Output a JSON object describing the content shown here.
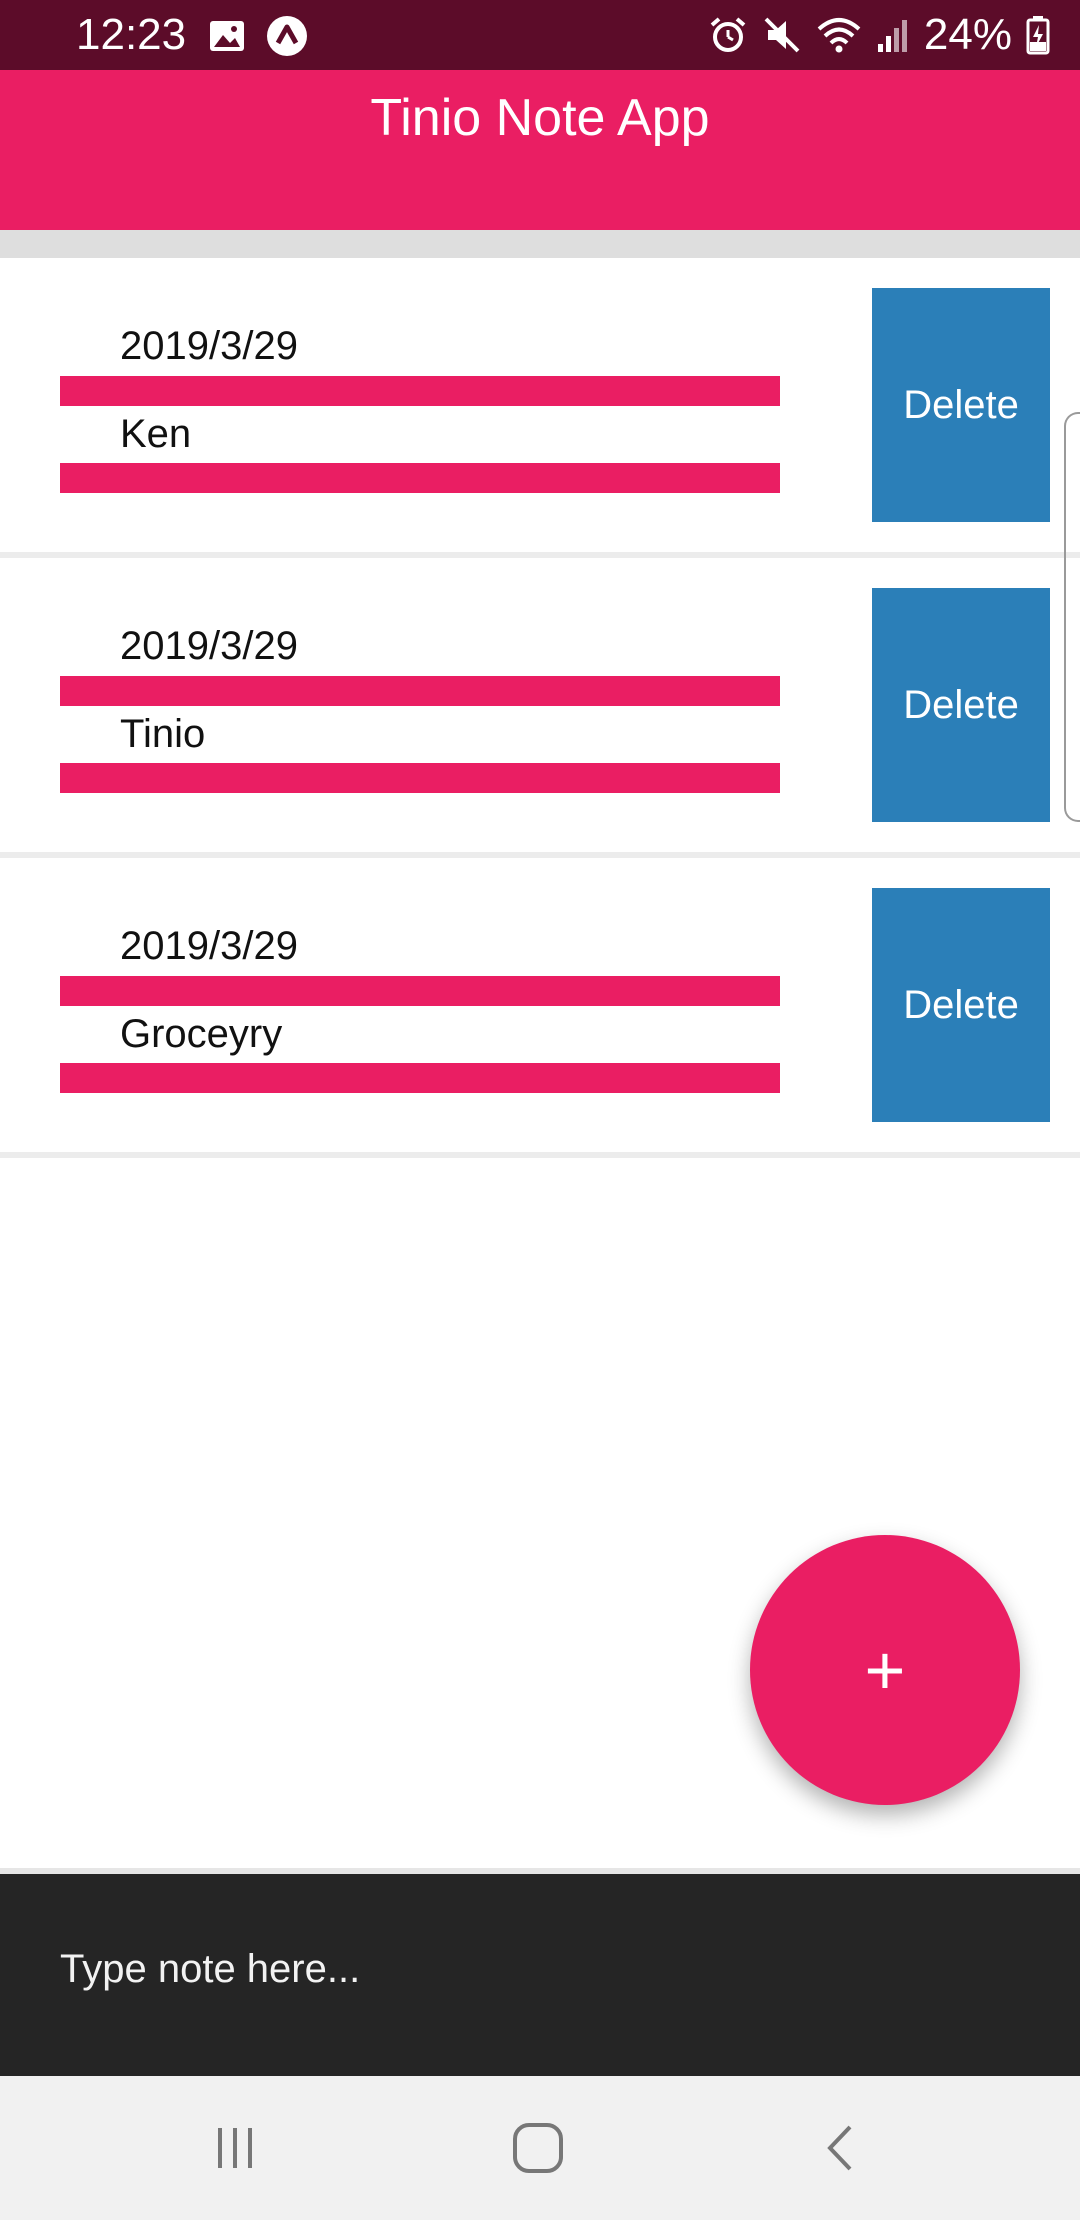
{
  "status_bar": {
    "time": "12:23",
    "battery": "24%",
    "icons": [
      "image-icon",
      "app-notification-icon",
      "alarm-icon",
      "mute-icon",
      "wifi-icon",
      "signal-icon",
      "battery-icon"
    ]
  },
  "app_bar": {
    "title": "Tinio Note App"
  },
  "notes": [
    {
      "date": "2019/3/29",
      "title": "Ken",
      "delete_label": "Delete"
    },
    {
      "date": "2019/3/29",
      "title": "Tinio",
      "delete_label": "Delete"
    },
    {
      "date": "2019/3/29",
      "title": "Groceyry",
      "delete_label": "Delete"
    }
  ],
  "fab": {
    "label": "+"
  },
  "input": {
    "placeholder": "Type note here..."
  },
  "nav_bar": {
    "icons": [
      "recent-apps-icon",
      "home-icon",
      "back-icon"
    ]
  },
  "colors": {
    "status_bar": "#5c0c29",
    "primary": "#ea1e63",
    "delete_button": "#2b7fb8",
    "input_bar": "#252525",
    "nav_bar": "#f1f1f1"
  }
}
